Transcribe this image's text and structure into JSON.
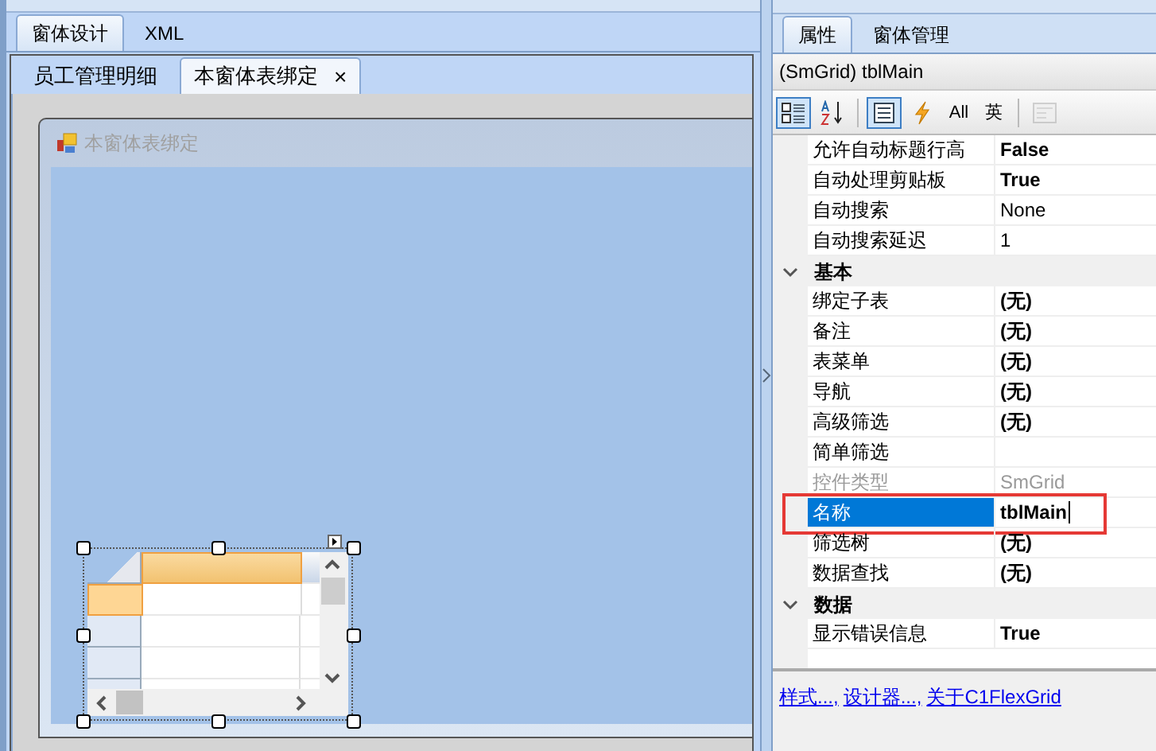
{
  "designer_tabs": [
    {
      "label": "窗体设计",
      "selected": true
    },
    {
      "label": "XML",
      "selected": false
    }
  ],
  "document_tabs": [
    {
      "label": "员工管理明细",
      "selected": false,
      "closable": false
    },
    {
      "label": "本窗体表绑定",
      "selected": true,
      "closable": true,
      "close_glyph": "×"
    }
  ],
  "form": {
    "title": "本窗体表绑定",
    "title_disabled": true
  },
  "panel_tabs": [
    {
      "label": "属性",
      "selected": true
    },
    {
      "label": "窗体管理",
      "selected": false
    }
  ],
  "object_header": "(SmGrid) tblMain",
  "toolbar": [
    {
      "kind": "categorized",
      "selected": true,
      "disabled": false
    },
    {
      "kind": "alphabetical",
      "selected": false,
      "disabled": false
    },
    {
      "kind": "separator"
    },
    {
      "kind": "properties",
      "selected": true,
      "disabled": false
    },
    {
      "kind": "events",
      "selected": false,
      "disabled": false
    },
    {
      "kind": "text",
      "label": "All",
      "selected": false,
      "disabled": false
    },
    {
      "kind": "text",
      "label": "英",
      "selected": false,
      "disabled": false
    },
    {
      "kind": "separator"
    },
    {
      "kind": "pages",
      "selected": false,
      "disabled": true
    }
  ],
  "properties": [
    {
      "kind": "property",
      "name": "允许自动标题行高",
      "value": "False",
      "bold": true,
      "disabled": false,
      "selected": false
    },
    {
      "kind": "property",
      "name": "自动处理剪贴板",
      "value": "True",
      "bold": true,
      "disabled": false,
      "selected": false
    },
    {
      "kind": "property",
      "name": "自动搜索",
      "value": "None",
      "bold": false,
      "disabled": false,
      "selected": false
    },
    {
      "kind": "property",
      "name": "自动搜索延迟",
      "value": "1",
      "bold": false,
      "disabled": false,
      "selected": false
    },
    {
      "kind": "category",
      "name": "基本",
      "expanded": true
    },
    {
      "kind": "property",
      "name": "绑定子表",
      "value": "(无)",
      "bold": true,
      "disabled": false,
      "selected": false
    },
    {
      "kind": "property",
      "name": "备注",
      "value": "(无)",
      "bold": true,
      "disabled": false,
      "selected": false
    },
    {
      "kind": "property",
      "name": "表菜单",
      "value": "(无)",
      "bold": true,
      "disabled": false,
      "selected": false
    },
    {
      "kind": "property",
      "name": "导航",
      "value": "(无)",
      "bold": true,
      "disabled": false,
      "selected": false
    },
    {
      "kind": "property",
      "name": "高级筛选",
      "value": "(无)",
      "bold": true,
      "disabled": false,
      "selected": false
    },
    {
      "kind": "property",
      "name": "简单筛选",
      "disabled": false,
      "selected": false
    },
    {
      "kind": "property",
      "name": "控件类型",
      "value": "SmGrid",
      "bold": false,
      "disabled": true,
      "selected": false
    },
    {
      "kind": "property",
      "name": "名称",
      "value": "tblMain",
      "bold": true,
      "disabled": false,
      "selected": true,
      "highlighted": true
    },
    {
      "kind": "property",
      "name": "筛选树",
      "value": "(无)",
      "bold": true,
      "disabled": false,
      "selected": false
    },
    {
      "kind": "property",
      "name": "数据查找",
      "value": "(无)",
      "bold": true,
      "disabled": false,
      "selected": false
    },
    {
      "kind": "category",
      "name": "数据",
      "expanded": true
    },
    {
      "kind": "property",
      "name": "显示错误信息",
      "value": "True",
      "bold": true,
      "disabled": false,
      "selected": false
    }
  ],
  "links": [
    "样式...,",
    "设计器...,",
    "关于C1FlexGrid"
  ]
}
